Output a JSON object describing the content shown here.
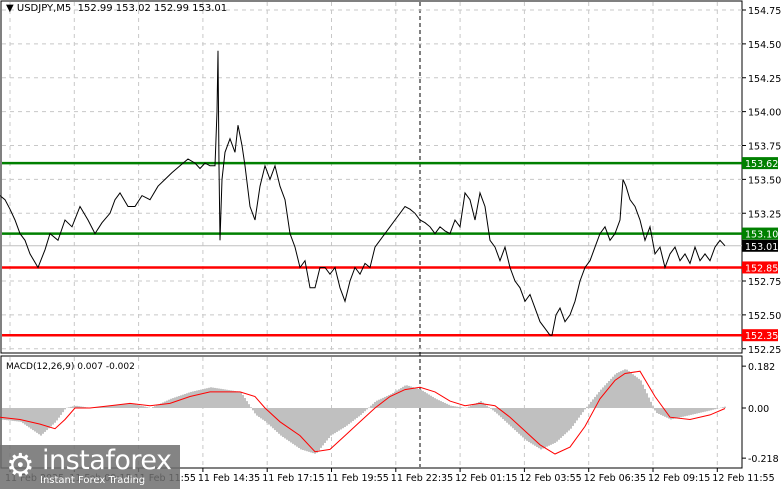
{
  "header": {
    "title": "USDJPY,M5",
    "ohlc": "152.99 153.02 152.99 153.01"
  },
  "macd_label": "MACD(12,26,9) 0.007 -0.002",
  "logo": {
    "name": "instaforex",
    "tagline": "Instant Forex Trading"
  },
  "colors": {
    "support": "#ff0000",
    "resistance": "#008000",
    "price": "#000000",
    "histogram": "#c0c0c0",
    "signal": "#ff0000"
  },
  "chart_data": [
    {
      "type": "line",
      "title": "USDJPY,M5",
      "ylim": [
        152.2,
        154.8
      ],
      "yticks": [
        "154.75",
        "154.50",
        "154.25",
        "154.00",
        "153.75",
        "153.50",
        "153.25",
        "152.75",
        "152.50",
        "152.25"
      ],
      "xticks": [
        "11 Feb 2025",
        "11 Feb 09:15",
        "11 Feb 11:55",
        "11 Feb 14:35",
        "11 Feb 17:15",
        "11 Feb 19:55",
        "11 Feb 22:35",
        "12 Feb 01:15",
        "12 Feb 03:55",
        "12 Feb 06:35",
        "12 Feb 09:15",
        "12 Feb 11:55"
      ],
      "levels": [
        {
          "value": 153.62,
          "label": "153.62",
          "color": "#008000"
        },
        {
          "value": 153.1,
          "label": "153.10",
          "color": "#008000"
        },
        {
          "value": 152.85,
          "label": "152.85",
          "color": "#ff0000"
        },
        {
          "value": 152.35,
          "label": "152.35",
          "color": "#ff0000"
        }
      ],
      "current": {
        "value": 153.01,
        "label": "153.01"
      },
      "x": [
        0,
        5,
        10,
        15,
        20,
        25,
        30,
        38,
        45,
        50,
        58,
        65,
        72,
        80,
        88,
        95,
        102,
        110,
        115,
        120,
        128,
        135,
        142,
        150,
        158,
        165,
        172,
        180,
        188,
        195,
        200,
        205,
        210,
        215,
        217,
        218,
        219,
        220,
        222,
        225,
        230,
        235,
        238,
        242,
        245,
        250,
        255,
        260,
        265,
        270,
        275,
        280,
        285,
        290,
        295,
        300,
        305,
        310,
        315,
        320,
        325,
        330,
        335,
        340,
        345,
        350,
        355,
        360,
        365,
        370,
        375,
        380,
        385,
        390,
        395,
        400,
        405,
        410,
        415,
        420,
        425,
        430,
        435,
        440,
        445,
        450,
        455,
        460,
        465,
        470,
        475,
        480,
        485,
        490,
        495,
        500,
        505,
        510,
        515,
        520,
        525,
        530,
        535,
        540,
        545,
        550,
        552,
        556,
        560,
        565,
        570,
        575,
        580,
        585,
        590,
        595,
        600,
        605,
        610,
        615,
        620,
        623,
        626,
        630,
        635,
        640,
        645,
        650,
        655,
        660,
        665,
        670,
        675,
        680,
        685,
        690,
        695,
        700,
        705,
        710,
        715,
        720,
        725
      ],
      "values": [
        153.38,
        153.35,
        153.28,
        153.2,
        153.1,
        153.05,
        152.95,
        152.85,
        152.98,
        153.1,
        153.05,
        153.2,
        153.15,
        153.3,
        153.2,
        153.1,
        153.18,
        153.25,
        153.35,
        153.4,
        153.3,
        153.3,
        153.38,
        153.35,
        153.45,
        153.5,
        153.55,
        153.6,
        153.65,
        153.62,
        153.58,
        153.62,
        153.6,
        153.6,
        154.0,
        154.45,
        153.6,
        153.05,
        153.5,
        153.7,
        153.8,
        153.7,
        153.9,
        153.75,
        153.6,
        153.3,
        153.2,
        153.45,
        153.6,
        153.5,
        153.6,
        153.45,
        153.35,
        153.1,
        153.0,
        152.85,
        152.9,
        152.7,
        152.7,
        152.85,
        152.85,
        152.8,
        152.85,
        152.7,
        152.6,
        152.75,
        152.85,
        152.8,
        152.88,
        152.85,
        153.0,
        153.05,
        153.1,
        153.15,
        153.2,
        153.25,
        153.3,
        153.28,
        153.25,
        153.2,
        153.18,
        153.15,
        153.1,
        153.15,
        153.12,
        153.1,
        153.2,
        153.15,
        153.4,
        153.35,
        153.2,
        153.4,
        153.3,
        153.05,
        153.0,
        152.9,
        153.0,
        152.85,
        152.75,
        152.7,
        152.6,
        152.65,
        152.55,
        152.45,
        152.4,
        152.35,
        152.35,
        152.5,
        152.55,
        152.45,
        152.5,
        152.6,
        152.75,
        152.85,
        152.9,
        153.0,
        153.1,
        153.15,
        153.05,
        153.1,
        153.2,
        153.5,
        153.45,
        153.35,
        153.3,
        153.2,
        153.05,
        153.15,
        152.95,
        153.0,
        152.85,
        152.95,
        153.0,
        152.9,
        152.95,
        152.88,
        153.0,
        152.9,
        152.95,
        152.9,
        153.0,
        153.05,
        153.01
      ]
    },
    {
      "type": "bar",
      "title": "MACD(12,26,9)",
      "ylim": [
        -0.218,
        0.182
      ],
      "yticks": [
        "0.182",
        "0.00",
        "-0.218"
      ],
      "x": [
        0,
        20,
        40,
        55,
        65,
        75,
        90,
        110,
        130,
        150,
        170,
        190,
        210,
        225,
        240,
        255,
        265,
        280,
        300,
        315,
        330,
        345,
        360,
        375,
        390,
        405,
        420,
        435,
        450,
        465,
        480,
        495,
        510,
        525,
        540,
        555,
        570,
        585,
        600,
        615,
        625,
        640,
        655,
        670,
        690,
        710,
        725
      ],
      "macd": [
        -0.05,
        -0.06,
        -0.12,
        -0.06,
        0.0,
        0.01,
        0.0,
        0.01,
        0.02,
        0.0,
        0.04,
        0.07,
        0.09,
        0.08,
        0.07,
        -0.03,
        -0.06,
        -0.12,
        -0.18,
        -0.2,
        -0.12,
        -0.08,
        -0.03,
        0.03,
        0.06,
        0.1,
        0.08,
        0.04,
        0.01,
        0.0,
        0.03,
        -0.02,
        -0.08,
        -0.14,
        -0.18,
        -0.15,
        -0.09,
        0.0,
        0.08,
        0.15,
        0.17,
        0.12,
        -0.02,
        -0.05,
        -0.03,
        -0.01,
        0.007
      ],
      "signal": [
        -0.04,
        -0.05,
        -0.07,
        -0.09,
        -0.05,
        0.0,
        0.0,
        0.01,
        0.02,
        0.01,
        0.02,
        0.05,
        0.07,
        0.07,
        0.07,
        0.05,
        0.0,
        -0.06,
        -0.12,
        -0.19,
        -0.18,
        -0.12,
        -0.06,
        0.0,
        0.05,
        0.08,
        0.09,
        0.07,
        0.03,
        0.01,
        0.02,
        0.01,
        -0.04,
        -0.1,
        -0.16,
        -0.2,
        -0.17,
        -0.08,
        0.04,
        0.12,
        0.15,
        0.16,
        0.05,
        -0.04,
        -0.05,
        -0.03,
        -0.002
      ]
    }
  ]
}
